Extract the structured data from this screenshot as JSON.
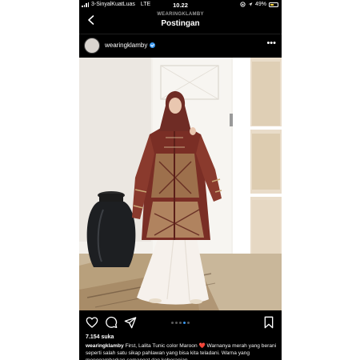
{
  "status_bar": {
    "carrier": "3-SinyalKuatLuas",
    "network": "LTE",
    "time": "10.22",
    "battery_percent": "49%",
    "battery_level": 0.49
  },
  "header": {
    "account": "WEARINGKLAMBY",
    "title": "Postingan"
  },
  "post": {
    "username": "wearingklamby",
    "verified": true,
    "likes": "7.154 suka",
    "caption_user": "wearingklamby",
    "caption_text": " First, Lalita Tunic color Maroon ❤️ Warnanya merah yang berani seperti salah satu sikap pahlawan yang bisa kita teladani. Warna yang menggambarkan semangat dan keberanian."
  },
  "carousel": {
    "count": 5,
    "active_index": 3
  },
  "icons": {
    "back": "chevron-left-icon",
    "more": "more-horizontal-icon",
    "like": "heart-icon",
    "comment": "comment-icon",
    "share": "send-icon",
    "save": "bookmark-icon"
  },
  "colors": {
    "background": "#000000",
    "text": "#ffffff",
    "verified": "#3897f0",
    "heart": "#e0245e",
    "battery": "#f6d33c"
  }
}
